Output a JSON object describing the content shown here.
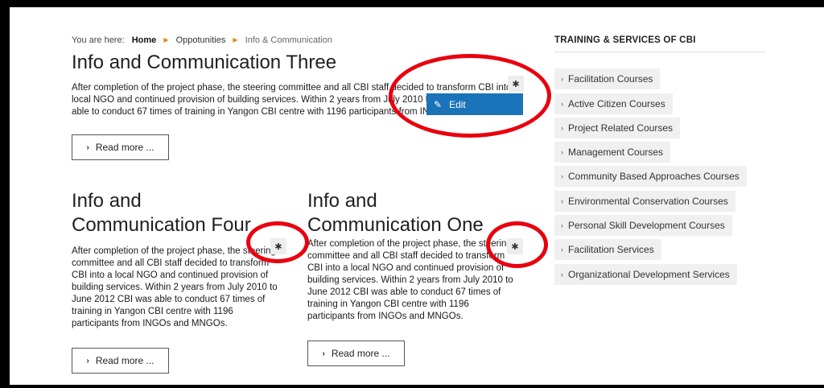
{
  "breadcrumb": {
    "prefix": "You are here:",
    "home": "Home",
    "section": "Oppotunities",
    "current": "Info & Communication"
  },
  "articles": [
    {
      "title": "Info and Communication Three",
      "body": "After completion of the project phase, the steering committee and all CBI staff decided to transform CBI into a local NGO and continued provision of building services. Within 2 years from July 2010 to June 2012 CBI was able to conduct 67 times of training in Yangon CBI centre with 1196 participants from INGOs and MNGOs.",
      "read_more": "Read more ..."
    },
    {
      "title": "Info and Communication Four",
      "body": "After completion of the project phase, the steering committee and all CBI staff decided to transform CBI into a local NGO and continued provision of building services. Within 2 years from July 2010 to June 2012 CBI was able to conduct 67 times of training in Yangon CBI centre with 1196 participants from INGOs and MNGOs.",
      "read_more": "Read more ..."
    },
    {
      "title": "Info and Communication One",
      "body": "After completion of the project phase, the steering committee and all CBI staff decided to transform CBI into a local NGO and continued provision of building services. Within 2 years from July 2010 to June 2012 CBI was able to conduct 67 times of training in Yangon CBI centre with 1196 participants from INGOs and MNGOs.",
      "read_more": "Read more ..."
    }
  ],
  "edit_menu": {
    "label": "Edit"
  },
  "sidebar": {
    "title": "TRAINING & SERVICES OF CBI",
    "items": [
      "Facilitation Courses",
      "Active Citizen Courses",
      "Project Related Courses",
      "Management Courses",
      "Community Based Approaches Courses",
      "Environmental Conservation Courses",
      "Personal Skill Development Courses",
      "Facilitation Services",
      "Organizational Development Services"
    ]
  },
  "icons": {
    "gear": "gear-icon",
    "edit": "edit-icon",
    "chevron": "chevron-right-icon"
  },
  "colors": {
    "accent": "#1a73b8",
    "annotation": "#e8000f",
    "breadcrumb_separator": "#e08a1e",
    "sidebar_item_bg": "#f0f0f0"
  }
}
